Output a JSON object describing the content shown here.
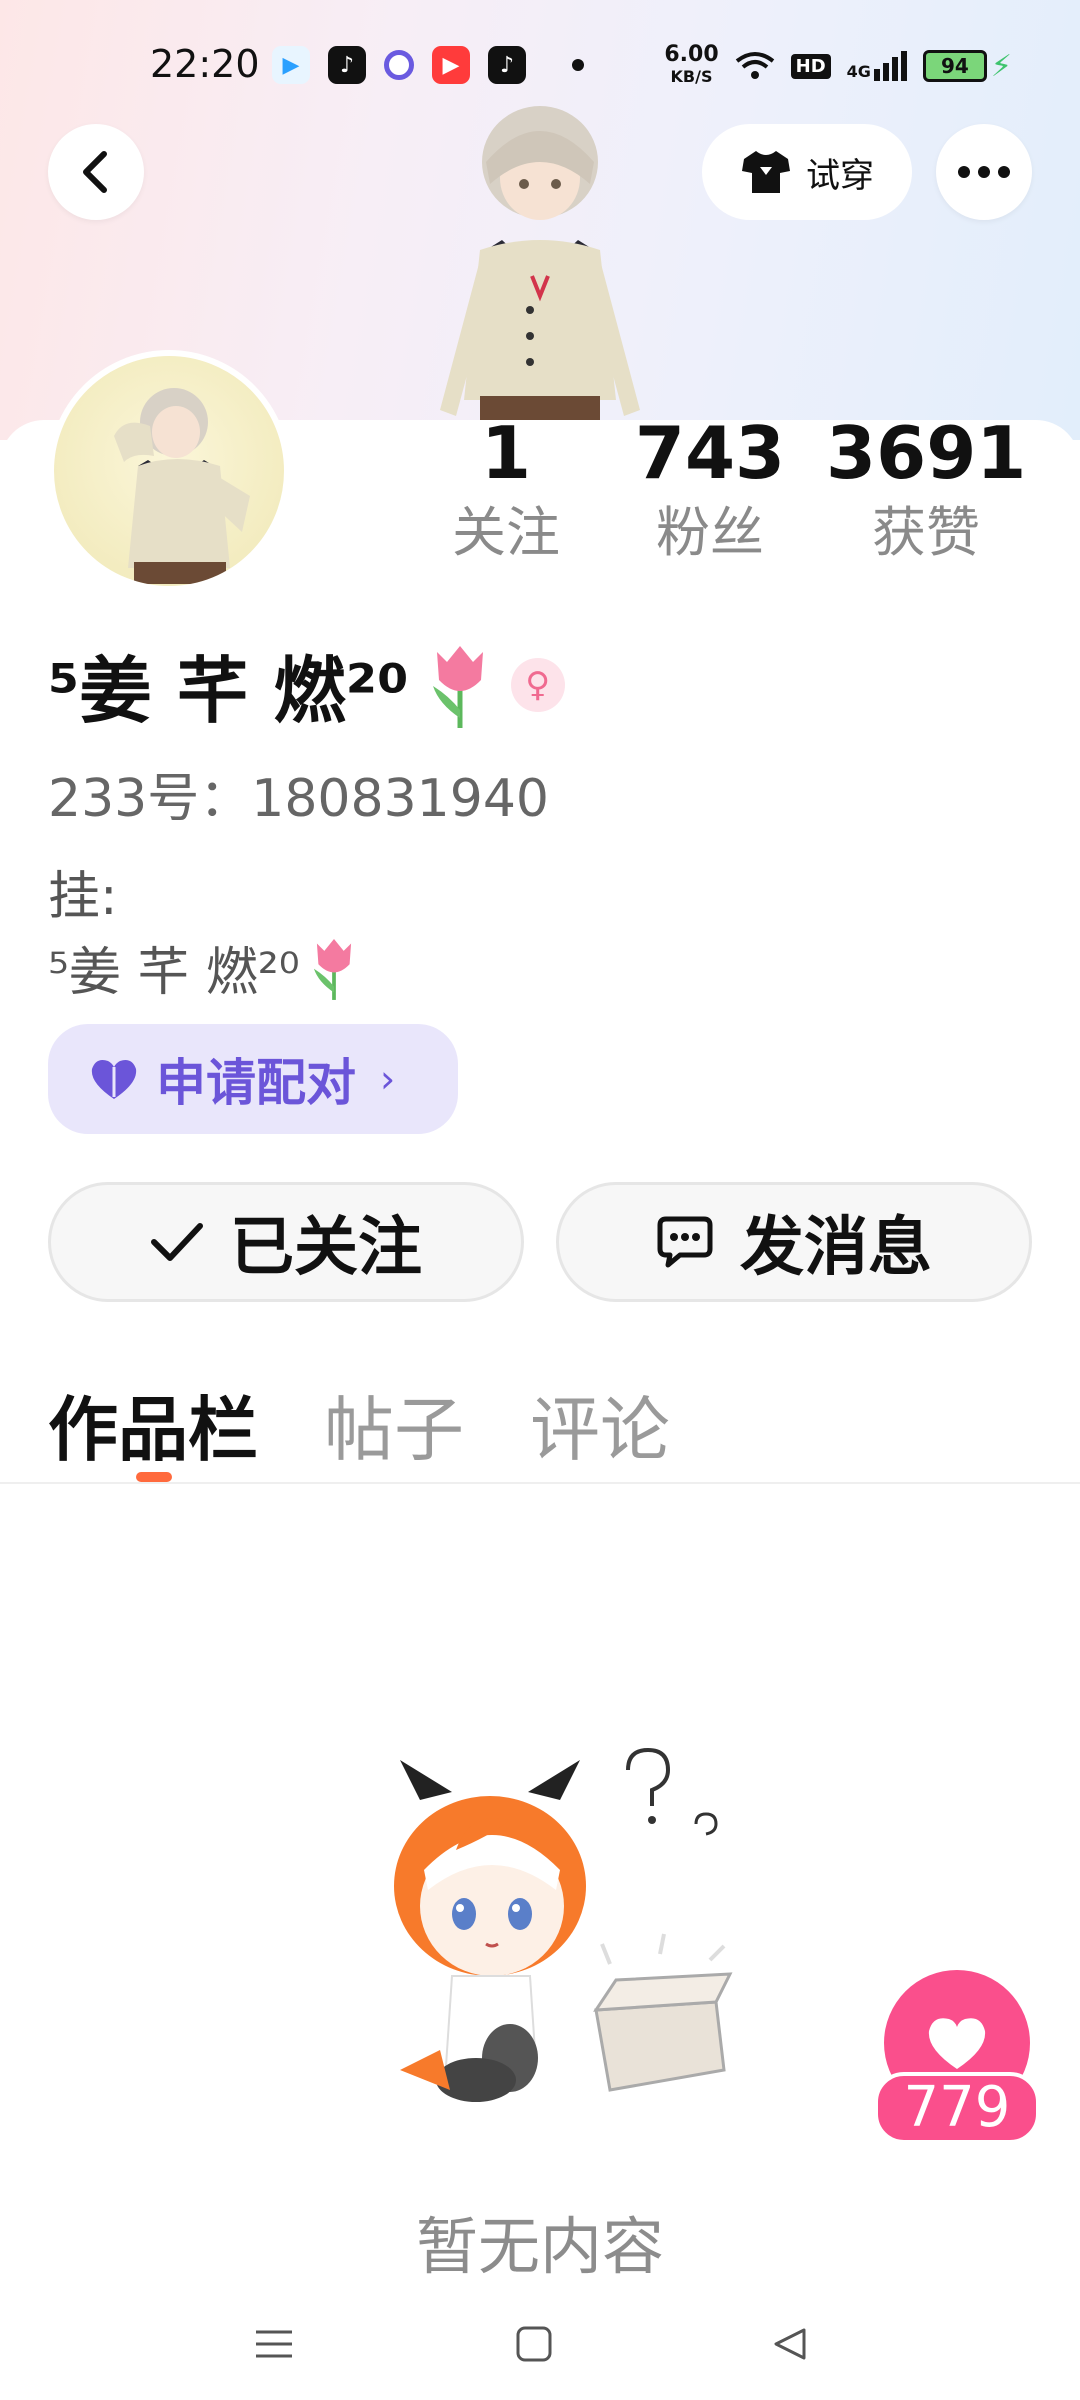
{
  "status_bar": {
    "time": "22:20",
    "net_speed_value": "6.00",
    "net_speed_unit": "KB/S",
    "hd": "HD",
    "signal": "4G",
    "battery": "94"
  },
  "header": {
    "tryon_label": "试穿"
  },
  "profile": {
    "stats": [
      {
        "num": "1",
        "label": "关注"
      },
      {
        "num": "743",
        "label": "粉丝"
      },
      {
        "num": "3691",
        "label": "获赞"
      }
    ],
    "name": "⁵姜 芊 燃²⁰",
    "uid_line": "233号：180831940",
    "hang_label": "挂:",
    "hang_value": "⁵姜 芊 燃²⁰",
    "pair_label": "申请配对",
    "pair_chevron": "›"
  },
  "actions": {
    "follow_label": "已关注",
    "message_label": "发消息"
  },
  "tabs": [
    {
      "label": "作品栏"
    },
    {
      "label": "帖子"
    },
    {
      "label": "评论"
    }
  ],
  "empty": {
    "text": "暂无内容"
  },
  "like_fab": {
    "count": "779"
  },
  "colors": {
    "accent_pink": "#fa4f8c",
    "pair_purple": "#6b55d9",
    "tab_indicator": "#ff6a3d"
  }
}
